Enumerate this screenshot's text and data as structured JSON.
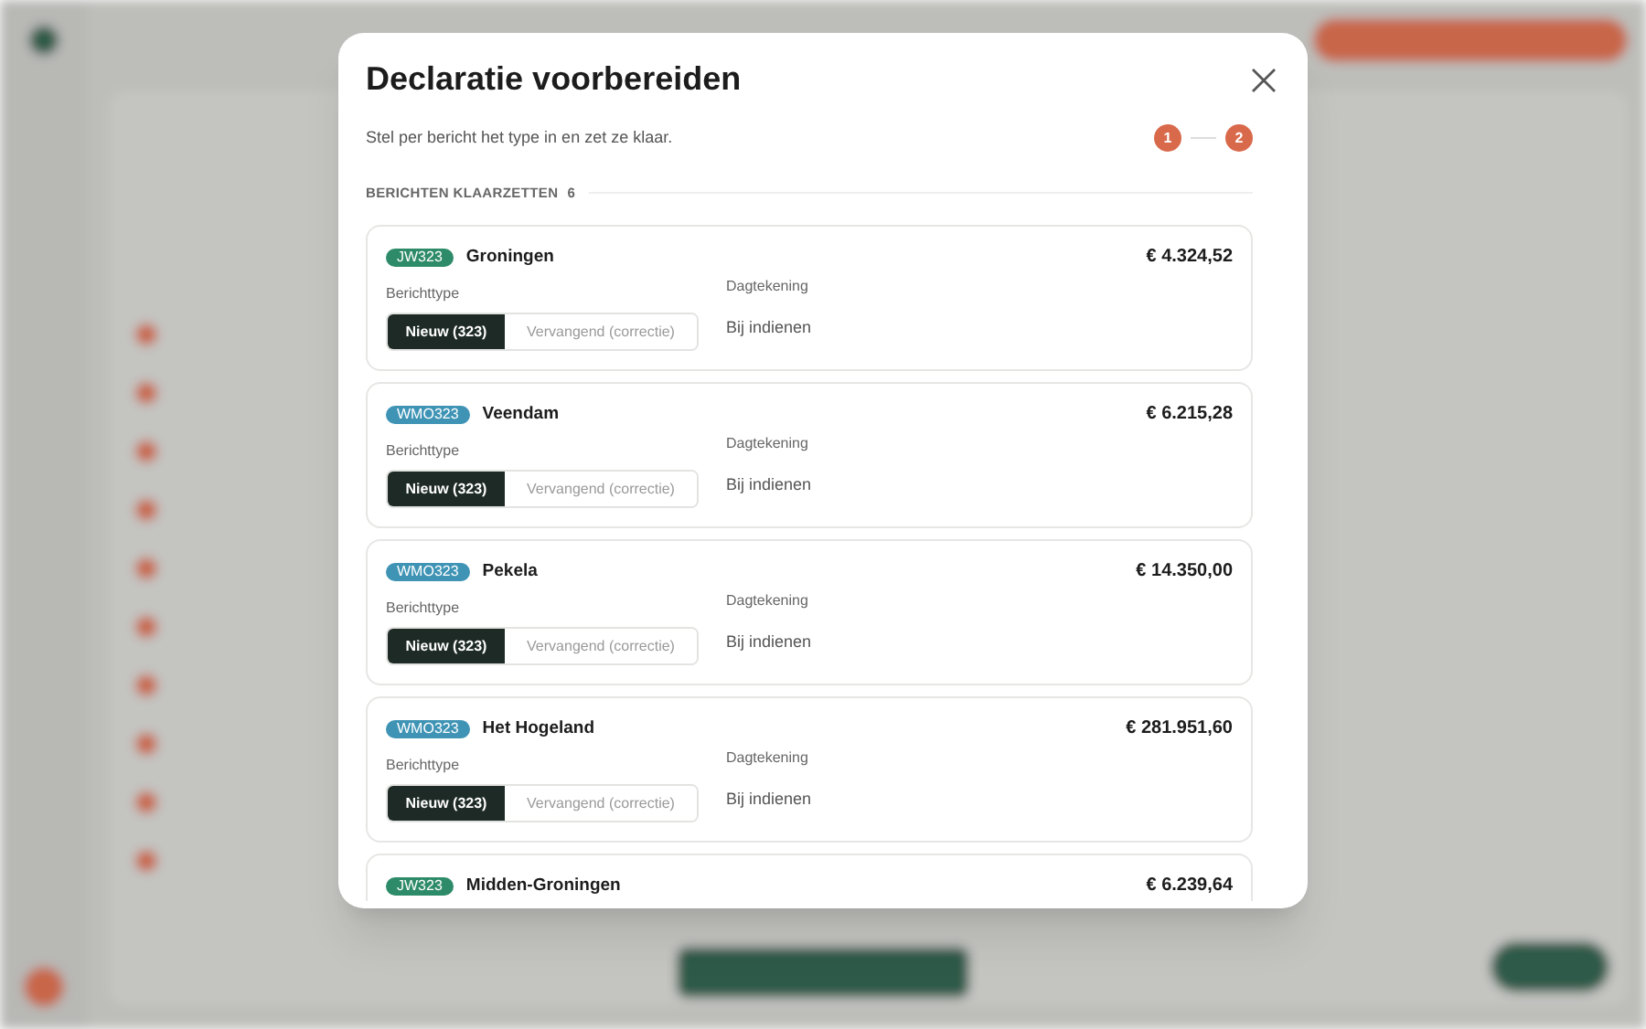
{
  "dialog": {
    "title": "Declaratie voorbereiden",
    "subtitle": "Stel per bericht het type in en zet ze klaar.",
    "steps": [
      "1",
      "2"
    ]
  },
  "section": {
    "title": "BERICHTEN KLAARZETTEN",
    "count": "6"
  },
  "messages": [
    {
      "code": "JW323",
      "color": "#2e8b6a",
      "name": "Groningen",
      "amount": "€ 4.324,52",
      "type_label": "Berichttype",
      "options": [
        {
          "label": "Nieuw (323)",
          "selected": true
        },
        {
          "label": "Vervangend (correctie)",
          "selected": false
        }
      ],
      "date_label": "Dagtekening",
      "date_value": "Bij indienen"
    },
    {
      "code": "WMO323",
      "color": "#3f94b5",
      "name": "Veendam",
      "amount": "€ 6.215,28",
      "type_label": "Berichttype",
      "options": [
        {
          "label": "Nieuw (323)",
          "selected": true
        },
        {
          "label": "Vervangend (correctie)",
          "selected": false
        }
      ],
      "date_label": "Dagtekening",
      "date_value": "Bij indienen"
    },
    {
      "code": "WMO323",
      "color": "#3f94b5",
      "name": "Pekela",
      "amount": "€ 14.350,00",
      "type_label": "Berichttype",
      "options": [
        {
          "label": "Nieuw (323)",
          "selected": true
        },
        {
          "label": "Vervangend (correctie)",
          "selected": false
        }
      ],
      "date_label": "Dagtekening",
      "date_value": "Bij indienen"
    },
    {
      "code": "WMO323",
      "color": "#3f94b5",
      "name": "Het Hogeland",
      "amount": "€ 281.951,60",
      "type_label": "Berichttype",
      "options": [
        {
          "label": "Nieuw (323)",
          "selected": true
        },
        {
          "label": "Vervangend (correctie)",
          "selected": false
        }
      ],
      "date_label": "Dagtekening",
      "date_value": "Bij indienen"
    },
    {
      "code": "JW323",
      "color": "#2e8b6a",
      "name": "Midden-Groningen",
      "amount": "€ 6.239,64"
    }
  ]
}
